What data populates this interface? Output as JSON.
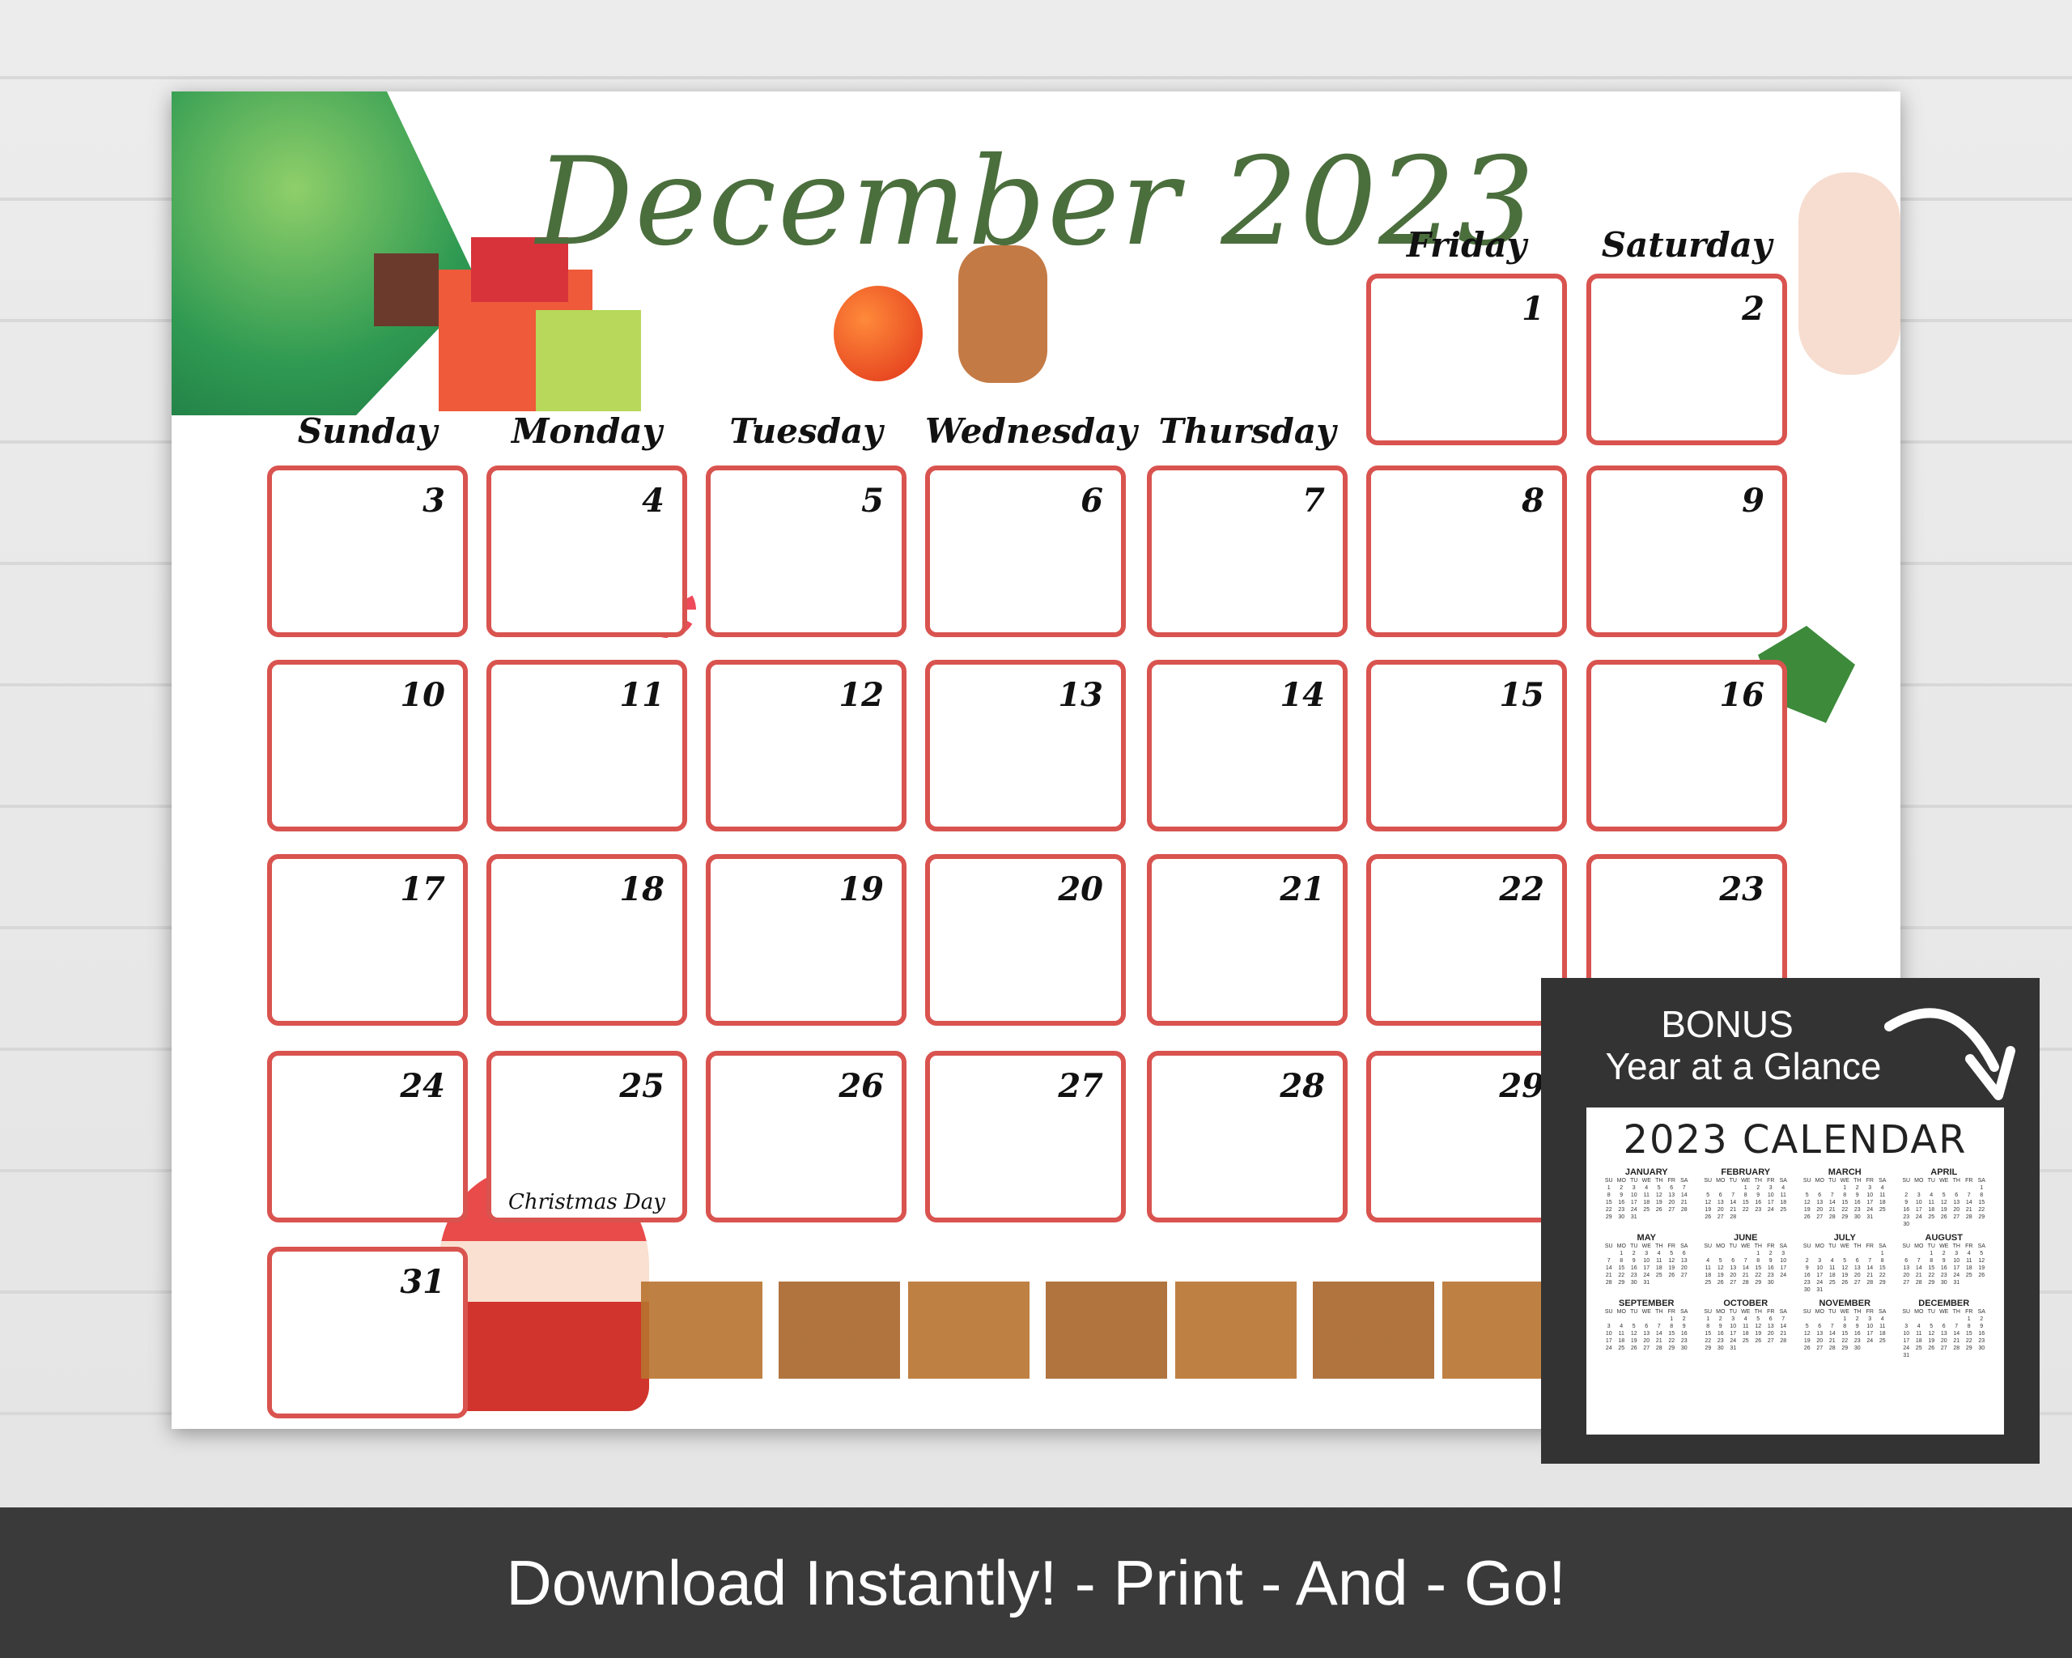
{
  "calendar": {
    "title": "December 2023",
    "weekdays": [
      "Sunday",
      "Monday",
      "Tuesday",
      "Wednesday",
      "Thursday",
      "Friday",
      "Saturday"
    ],
    "weeks": [
      [
        null,
        null,
        null,
        null,
        null,
        {
          "day": "1"
        },
        {
          "day": "2"
        }
      ],
      [
        {
          "day": "3"
        },
        {
          "day": "4"
        },
        {
          "day": "5"
        },
        {
          "day": "6"
        },
        {
          "day": "7"
        },
        {
          "day": "8"
        },
        {
          "day": "9"
        }
      ],
      [
        {
          "day": "10"
        },
        {
          "day": "11"
        },
        {
          "day": "12"
        },
        {
          "day": "13"
        },
        {
          "day": "14"
        },
        {
          "day": "15"
        },
        {
          "day": "16"
        }
      ],
      [
        {
          "day": "17"
        },
        {
          "day": "18"
        },
        {
          "day": "19"
        },
        {
          "day": "20"
        },
        {
          "day": "21"
        },
        {
          "day": "22"
        },
        {
          "day": "23"
        }
      ],
      [
        {
          "day": "24"
        },
        {
          "day": "25",
          "note": "Christmas Day"
        },
        {
          "day": "26"
        },
        {
          "day": "27"
        },
        {
          "day": "28"
        },
        {
          "day": "29"
        },
        null
      ],
      [
        {
          "day": "31"
        },
        null,
        null,
        null,
        null,
        null,
        null
      ]
    ],
    "accent": "#d9534f",
    "title_color": "#4b6e3d"
  },
  "bonus": {
    "line1": "BONUS",
    "line2": "Year at a Glance",
    "mini_title": "2023 CALENDAR",
    "weekday_abbr": [
      "SU",
      "MO",
      "TU",
      "WE",
      "TH",
      "FR",
      "SA"
    ],
    "months": [
      {
        "name": "JANUARY",
        "start": 0,
        "days": 31
      },
      {
        "name": "FEBRUARY",
        "start": 3,
        "days": 28
      },
      {
        "name": "MARCH",
        "start": 3,
        "days": 31
      },
      {
        "name": "APRIL",
        "start": 6,
        "days": 30
      },
      {
        "name": "MAY",
        "start": 1,
        "days": 31
      },
      {
        "name": "JUNE",
        "start": 4,
        "days": 30
      },
      {
        "name": "JULY",
        "start": 6,
        "days": 31
      },
      {
        "name": "AUGUST",
        "start": 2,
        "days": 31
      },
      {
        "name": "SEPTEMBER",
        "start": 5,
        "days": 30
      },
      {
        "name": "OCTOBER",
        "start": 0,
        "days": 31
      },
      {
        "name": "NOVEMBER",
        "start": 3,
        "days": 30
      },
      {
        "name": "DECEMBER",
        "start": 5,
        "days": 31
      }
    ]
  },
  "banner": {
    "text": "Download Instantly! - Print - And - Go!"
  },
  "decorations": [
    "christmas-tree",
    "gift-boxes",
    "ornament",
    "gingerbread-man",
    "wreath",
    "snowman",
    "snowflake",
    "peppermint-candy",
    "holly",
    "candy-cane",
    "star",
    "santa",
    "reindeer"
  ]
}
